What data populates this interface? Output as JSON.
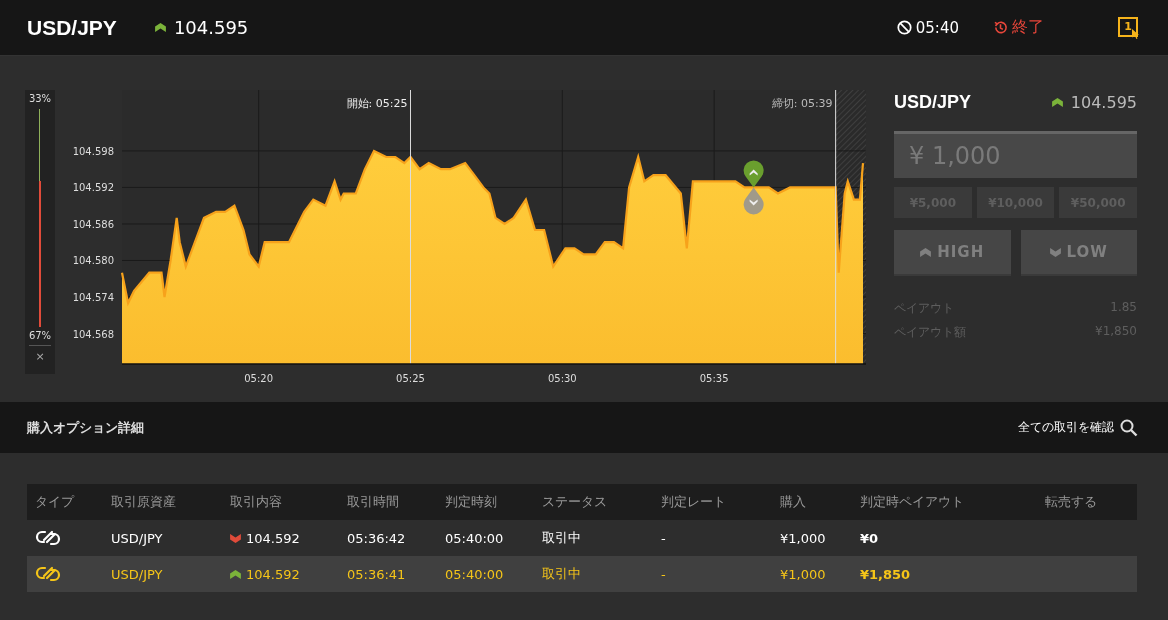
{
  "header": {
    "symbol": "USD/JPY",
    "price": "104.595",
    "rising": true,
    "timer": "05:40",
    "status": "終了",
    "badge": "1"
  },
  "sentiment": {
    "top_label": "33%",
    "bottom_label": "67%",
    "level": 0.33,
    "close": "×"
  },
  "chart": {
    "start_label": "開始: 05:25",
    "end_label": "締切: 05:39",
    "chart_data": {
      "type": "area",
      "x": [
        315.5,
        315.7,
        315.9,
        316.4,
        316.8,
        316.9,
        317.1,
        317.3,
        317.4,
        317.6,
        317.9,
        318.2,
        318.6,
        318.9,
        319.2,
        319.5,
        319.7,
        320.0,
        320.2,
        320.5,
        321.0,
        321.3,
        321.5,
        321.8,
        322.2,
        322.5,
        322.7,
        322.8,
        323.2,
        323.5,
        323.8,
        324.2,
        324.5,
        324.8,
        325.0,
        325.3,
        325.6,
        326.0,
        326.3,
        326.8,
        327.1,
        327.4,
        327.6,
        327.8,
        328.1,
        328.4,
        328.8,
        329.1,
        329.4,
        329.7,
        330.1,
        330.4,
        330.7,
        331.1,
        331.4,
        331.7,
        332.0,
        332.2,
        332.5,
        332.7,
        333.0,
        333.4,
        333.9,
        334.1,
        334.3,
        334.5,
        335.2,
        335.7,
        336.0,
        336.3,
        336.8,
        337.1,
        337.5,
        337.8,
        338.1,
        338.5,
        339.0,
        339.1,
        339.3,
        339.4,
        339.6,
        339.8,
        339.9
      ],
      "series": [
        {
          "color": "#f7a21b",
          "values": [
            104.578,
            104.573,
            104.575,
            104.578,
            104.578,
            104.574,
            104.58,
            104.587,
            104.583,
            104.579,
            104.583,
            104.587,
            104.588,
            104.588,
            104.589,
            104.585,
            104.581,
            104.579,
            104.583,
            104.583,
            104.583,
            104.586,
            104.588,
            104.59,
            104.589,
            104.593,
            104.59,
            104.591,
            104.591,
            104.595,
            104.598,
            104.597,
            104.597,
            104.596,
            104.597,
            104.595,
            104.596,
            104.595,
            104.595,
            104.596,
            104.594,
            104.592,
            104.591,
            104.587,
            104.586,
            104.587,
            104.59,
            104.585,
            104.585,
            104.579,
            104.582,
            104.582,
            104.581,
            104.581,
            104.583,
            104.583,
            104.582,
            104.592,
            104.597,
            104.593,
            104.594,
            104.594,
            104.591,
            104.582,
            104.593,
            104.593,
            104.593,
            104.593,
            104.592,
            104.592,
            104.592,
            104.591,
            104.592,
            104.592,
            104.592,
            104.592,
            104.592,
            104.578,
            104.591,
            104.593,
            104.59,
            104.59,
            104.596
          ]
        }
      ],
      "xlim": [
        315.5,
        340
      ],
      "ylim": [
        104.563,
        104.608
      ],
      "xticks": [
        {
          "value": 320,
          "label": "05:20"
        },
        {
          "value": 325,
          "label": "05:25"
        },
        {
          "value": 330,
          "label": "05:30"
        },
        {
          "value": 335,
          "label": "05:35"
        }
      ],
      "grid": true,
      "ref_lines": [
        {
          "axis": "x",
          "value": 325
        },
        {
          "axis": "x",
          "value": 339
        }
      ],
      "bands": [
        {
          "axis": "x",
          "from": 339,
          "to": 340
        }
      ],
      "yticks": [
        {
          "value": 104.568,
          "label": "104.568"
        },
        {
          "value": 104.574,
          "label": "104.574"
        },
        {
          "value": 104.58,
          "label": "104.580"
        },
        {
          "value": 104.586,
          "label": "104.586"
        },
        {
          "value": 104.592,
          "label": "104.592"
        },
        {
          "value": 104.598,
          "label": "104.598"
        }
      ]
    }
  },
  "trade_panel": {
    "symbol": "USD/JPY",
    "price": "104.595",
    "rising": true,
    "amount_placeholder": "¥ 1,000",
    "presets": [
      "¥5,000",
      "¥10,000",
      "¥50,000"
    ],
    "buttons": [
      {
        "label": "HIGH",
        "kind": "high",
        "disabled": true
      },
      {
        "label": "LOW",
        "kind": "low",
        "disabled": true
      }
    ],
    "payout": [
      {
        "label": "ペイアウト",
        "value": "1.85"
      },
      {
        "label": "ペイアウト額",
        "value": "¥1,850"
      }
    ]
  },
  "details": {
    "title": "購入オプション詳細",
    "link": "全ての取引を確認"
  },
  "table": {
    "columns": [
      "タイプ",
      "取引原資産",
      "取引内容",
      "取引時間",
      "判定時刻",
      "ステータス",
      "判定レート",
      "購入",
      "判定時ペイアウト",
      "転売する"
    ],
    "rows": [
      {
        "highlighted": false,
        "rising": false,
        "cells": [
          "",
          "USD/JPY",
          "104.592",
          "05:36:42",
          "05:40:00",
          "取引中",
          "-",
          "¥1,000",
          "¥0"
        ]
      },
      {
        "highlighted": true,
        "rising": true,
        "cells": [
          "",
          "USD/JPY",
          "104.592",
          "05:36:41",
          "05:40:00",
          "取引中",
          "-",
          "¥1,000",
          "¥1,850"
        ]
      }
    ]
  }
}
